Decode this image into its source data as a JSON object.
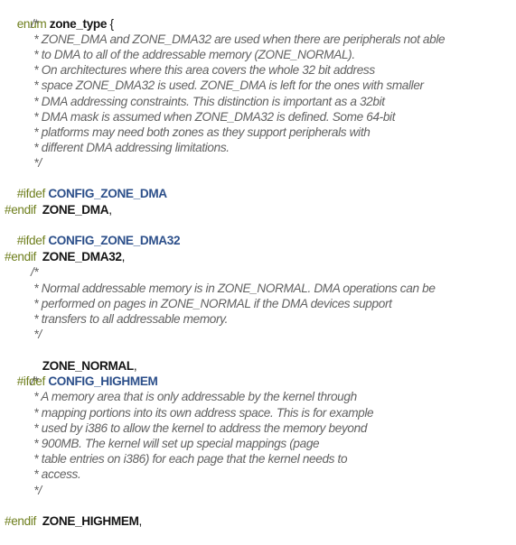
{
  "enum": {
    "keyword": "enum",
    "name": "zone_type",
    "open_brace": "{"
  },
  "comment1": [
    "/*",
    " * ZONE_DMA and ZONE_DMA32 are used when there are peripherals not able",
    " * to DMA to all of the addressable memory (ZONE_NORMAL).",
    " * On architectures where this area covers the whole 32 bit address",
    " * space ZONE_DMA32 is used. ZONE_DMA is left for the ones with smaller",
    " * DMA addressing constraints. This distinction is important as a 32bit",
    " * DMA mask is assumed when ZONE_DMA32 is defined. Some 64-bit",
    " * platforms may need both zones as they support peripherals with",
    " * different DMA addressing limitations.",
    " */"
  ],
  "ifdef_keyword": "#ifdef",
  "endif_keyword": "#endif",
  "configs": {
    "dma": "CONFIG_ZONE_DMA",
    "dma32": "CONFIG_ZONE_DMA32",
    "highmem": "CONFIG_HIGHMEM"
  },
  "members": {
    "dma": "ZONE_DMA",
    "dma32": "ZONE_DMA32",
    "normal": "ZONE_NORMAL",
    "highmem": "ZONE_HIGHMEM"
  },
  "comma": ",",
  "comment2": [
    "/*",
    " * Normal addressable memory is in ZONE_NORMAL. DMA operations can be",
    " * performed on pages in ZONE_NORMAL if the DMA devices support",
    " * transfers to all addressable memory.",
    " */"
  ],
  "comment3": [
    "/*",
    " * A memory area that is only addressable by the kernel through",
    " * mapping portions into its own address space. This is for example",
    " * used by i386 to allow the kernel to address the memory beyond",
    " * 900MB. The kernel will set up special mappings (page",
    " * table entries on i386) for each page that the kernel needs to",
    " * access.",
    " */"
  ]
}
